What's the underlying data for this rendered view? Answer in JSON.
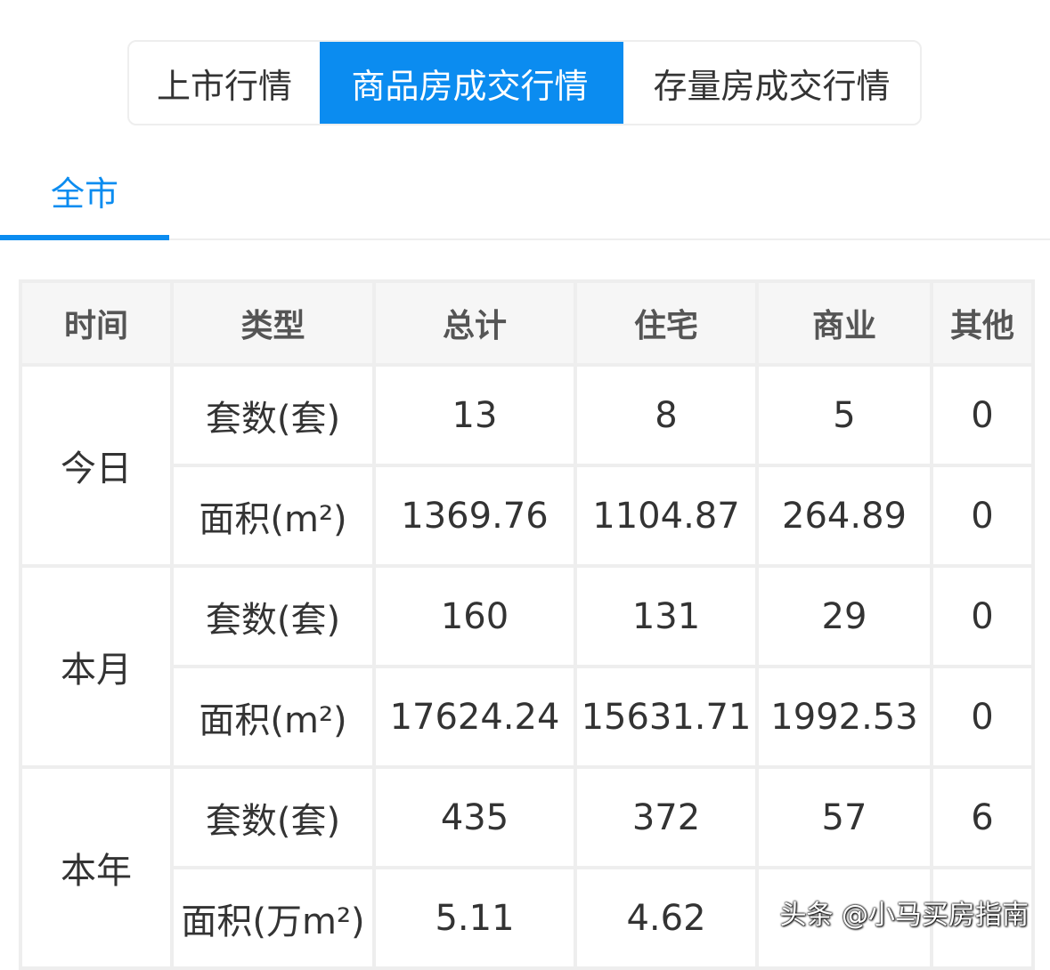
{
  "tabs": [
    {
      "label": "上市行情",
      "active": false
    },
    {
      "label": "商品房成交行情",
      "active": true
    },
    {
      "label": "存量房成交行情",
      "active": false
    }
  ],
  "area_tab": {
    "label": "全市",
    "active": true
  },
  "table": {
    "headers": [
      "时间",
      "类型",
      "总计",
      "住宅",
      "商业",
      "其他"
    ],
    "groups": [
      {
        "period": "今日",
        "rows": [
          {
            "type": "套数(套)",
            "total": "13",
            "residential": "8",
            "commercial": "5",
            "other": "0"
          },
          {
            "type": "面积(m²)",
            "total": "1369.76",
            "residential": "1104.87",
            "commercial": "264.89",
            "other": "0"
          }
        ]
      },
      {
        "period": "本月",
        "rows": [
          {
            "type": "套数(套)",
            "total": "160",
            "residential": "131",
            "commercial": "29",
            "other": "0"
          },
          {
            "type": "面积(m²)",
            "total": "17624.24",
            "residential": "15631.71",
            "commercial": "1992.53",
            "other": "0"
          }
        ]
      },
      {
        "period": "本年",
        "rows": [
          {
            "type": "套数(套)",
            "total": "435",
            "residential": "372",
            "commercial": "57",
            "other": "6"
          },
          {
            "type": "面积(万m²)",
            "total": "5.11",
            "residential": "4.62",
            "commercial": "",
            "other": ""
          }
        ]
      }
    ]
  },
  "watermark": "头条 @小马买房指南",
  "colors": {
    "accent": "#0b8cf0",
    "header_bg": "#f6f6f6",
    "border": "#eeeeee"
  }
}
